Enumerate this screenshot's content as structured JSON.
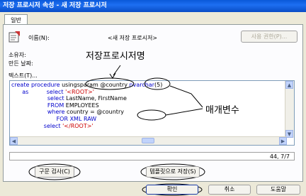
{
  "window": {
    "title": "저장 프로시저 속성 - 새 저장 프로시저"
  },
  "tabs": [
    {
      "label": "일반"
    }
  ],
  "general": {
    "name_label": "이름(N):",
    "name_value": "<새 저장 프로시저>",
    "permission_button": "사용 권한(P)...",
    "owner_label": "소유자:",
    "created_label": "만든 날짜:",
    "text_label": "텍스트(T)..."
  },
  "editor": {
    "lines": [
      [
        {
          "t": "create procedure ",
          "c": "kw"
        },
        {
          "t": "usingsparam",
          "c": ""
        },
        {
          "t": " @country ",
          "c": ""
        },
        {
          "t": "nvarchar",
          "c": "kw"
        },
        {
          "t": "(5)",
          "c": ""
        }
      ],
      [
        {
          "t": "      as          ",
          "c": "kw"
        },
        {
          "t": "select ",
          "c": "kw"
        },
        {
          "t": "'<ROOT>'",
          "c": "str"
        }
      ],
      [
        {
          "t": "                    select ",
          "c": "kw"
        },
        {
          "t": "LastName, FirstName",
          "c": ""
        }
      ],
      [
        {
          "t": "                    FROM ",
          "c": "kw"
        },
        {
          "t": "EMPLOYEES",
          "c": ""
        }
      ],
      [
        {
          "t": "                    where ",
          "c": "kw"
        },
        {
          "t": "country = @country",
          "c": ""
        }
      ],
      [
        {
          "t": "                         FOR XML RAW",
          "c": "kw"
        }
      ],
      [
        {
          "t": "                  select ",
          "c": "kw"
        },
        {
          "t": "'</ROOT>'",
          "c": "str"
        }
      ]
    ],
    "cursor_position": "44, 7/7"
  },
  "annotations": {
    "procedure_name": "저장프로시저명",
    "parameter": "매개변수"
  },
  "buttons": {
    "syntax_check": "구문 검사(C)",
    "save_as_template": "템플릿으로 저장(S)",
    "ok": "확인",
    "cancel": "취소",
    "help": "도움말"
  },
  "colors": {
    "titlebar": "#0a58d8",
    "keyword": "#0000cc",
    "string": "#cc0000",
    "dialog": "#ece9d8"
  }
}
